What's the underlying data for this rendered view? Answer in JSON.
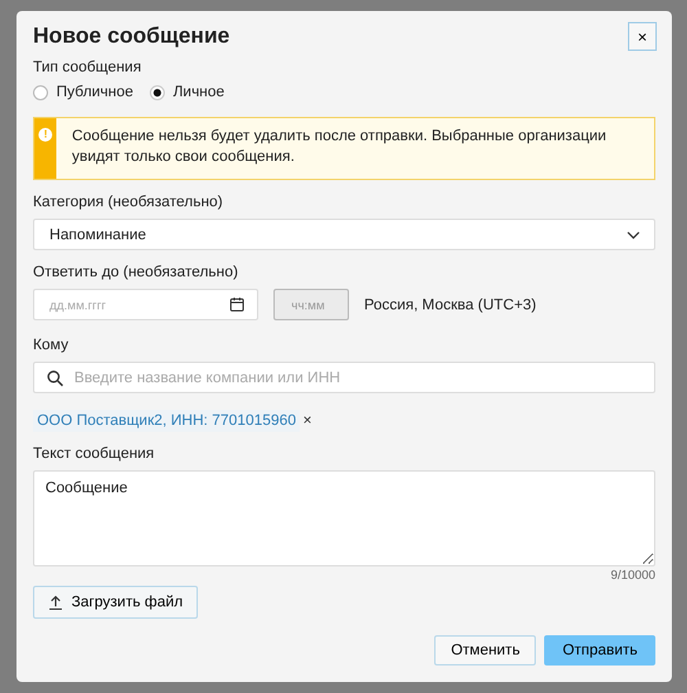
{
  "dialog": {
    "title": "Новое сообщение",
    "close": "×"
  },
  "message_type": {
    "label": "Тип сообщения",
    "options": [
      {
        "label": "Публичное",
        "selected": false
      },
      {
        "label": "Личное",
        "selected": true
      }
    ]
  },
  "alert": {
    "icon": "!",
    "text": "Сообщение нельзя будет удалить после отправки. Выбранные организации увидят только свои сообщения."
  },
  "category": {
    "label": "Категория (необязательно)",
    "value": "Напоминание"
  },
  "reply_by": {
    "label": "Ответить до (необязательно)",
    "date_placeholder": "дд.мм.гггг",
    "time_placeholder": "чч:мм",
    "timezone": "Россия, Москва (UTC+3)"
  },
  "recipient": {
    "label": "Кому",
    "placeholder": "Введите название компании или ИНН",
    "chips": [
      {
        "text": "ООО Поставщик2, ИНН: 7701015960",
        "remove": "×"
      }
    ]
  },
  "message": {
    "label": "Текст сообщения",
    "value": "Сообщение",
    "counter": "9/10000"
  },
  "upload_button": "Загрузить файл",
  "buttons": [
    {
      "label": "Отменить",
      "kind": "secondary"
    },
    {
      "label": "Отправить",
      "kind": "primary"
    }
  ]
}
